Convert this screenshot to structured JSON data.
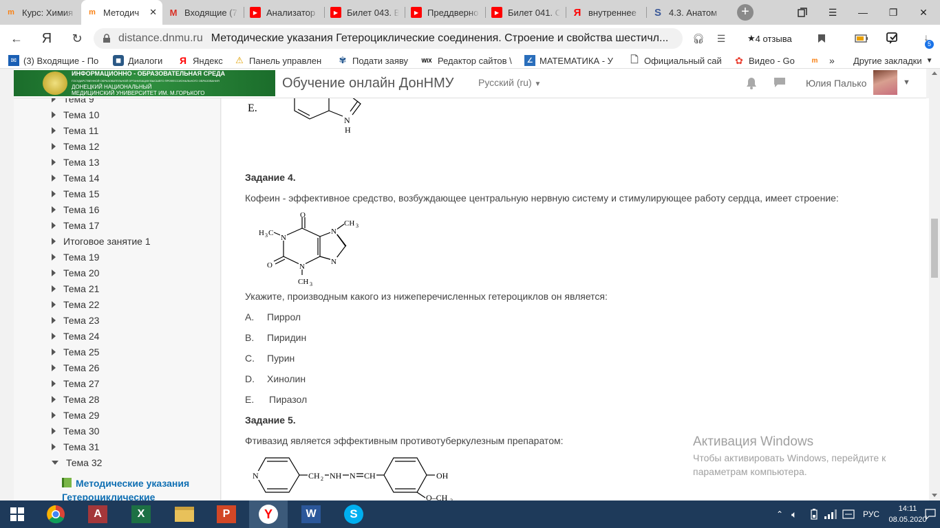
{
  "tabs": [
    {
      "title": "Курс: Химия",
      "icon": "moodle-icon",
      "color": "#f98012"
    },
    {
      "title": "Методич",
      "icon": "moodle-icon",
      "color": "#f98012",
      "active": true
    },
    {
      "title": "Входящие (7",
      "icon": "gmail-icon",
      "color": "#d93025"
    },
    {
      "title": "Анализатор",
      "icon": "youtube-icon",
      "color": "#ff0000"
    },
    {
      "title": "Билет 043. В",
      "icon": "youtube-icon",
      "color": "#ff0000"
    },
    {
      "title": "Преддверно",
      "icon": "youtube-icon",
      "color": "#ff0000"
    },
    {
      "title": "Билет 041. С",
      "icon": "youtube-icon",
      "color": "#ff0000"
    },
    {
      "title": "внутреннее",
      "icon": "yandex-icon",
      "color": "#ff0000"
    },
    {
      "title": "4.3. Анатом",
      "icon": "s-icon",
      "color": "#3b5998"
    }
  ],
  "addressbar": {
    "host": "distance.dnmu.ru",
    "page_title": "Методические указания Гетероциклические соединения. Строение и свойства шестичл...",
    "reviews": "4 отзыва",
    "downloads_badge": "5"
  },
  "bookmarks": [
    {
      "label": "(3) Входящие - По",
      "icon": "mail-icon",
      "color": "#1a5fb4"
    },
    {
      "label": "Диалоги",
      "icon": "chat-icon",
      "color": "#2a5885"
    },
    {
      "label": "Яндекс",
      "icon": "yandex-icon",
      "color": "#ff0000"
    },
    {
      "label": "Панель управлен",
      "icon": "panel-icon",
      "color": "#e0a000"
    },
    {
      "label": "Подати заяву",
      "icon": "emblem-icon",
      "color": "#1a4f8a"
    },
    {
      "label": "Редактор сайтов \\",
      "icon": "wix-icon",
      "color": "#000000"
    },
    {
      "label": "МАТЕМАТИКА - У",
      "icon": "math-icon",
      "color": "#2a6ebb"
    },
    {
      "label": "Официальный сай",
      "icon": "page-icon",
      "color": "#666666"
    },
    {
      "label": "Видео - Go",
      "icon": "photos-icon",
      "color": "#ea4335"
    },
    {
      "label": "",
      "icon": "moodle-icon",
      "color": "#f98012"
    }
  ],
  "bookmarks_other": "Другие закладки",
  "header": {
    "logo_line1": "ИНФОРМАЦИОННО - ОБРАЗОВАТЕЛЬНАЯ СРЕДА",
    "logo_line2": "ГОСУДАРСТВЕННОЙ ОБРАЗОВАТЕЛЬНОЙ ОРГАНИЗАЦИИ ВЫСШЕГО ПРОФЕССИОНАЛЬНОГО ОБРАЗОВАНИЯ",
    "logo_line3": "ДОНЕЦКИЙ НАЦИОНАЛЬНЫЙ",
    "logo_line4": "МЕДИЦИНСКИЙ УНИВЕРСИТЕТ ИМ. М.ГОРЬКОГО",
    "site_name": "Обучение онлайн ДонНМУ",
    "language": "Русский (ru)",
    "user_name": "Юлия Палько"
  },
  "sidebar": {
    "items": [
      "Тема 9",
      "Тема 10",
      "Тема 11",
      "Тема 12",
      "Тема 13",
      "Тема 14",
      "Тема 15",
      "Тема 16",
      "Тема 17",
      "Итоговое занятие 1",
      "Тема 19",
      "Тема 20",
      "Тема 21",
      "Тема 22",
      "Тема 23",
      "Тема 24",
      "Тема 25",
      "Тема 26",
      "Тема 27",
      "Тема 28",
      "Тема 29",
      "Тема 30",
      "Тема 31",
      "Тема 32"
    ],
    "active_line1": "Методические указания",
    "active_line2": "Гетероциклические"
  },
  "content": {
    "prev_option_letter": "E.",
    "task4_title": "Задание 4.",
    "task4_text": "Кофеин - эффективное средство, возбуждающее центральную нервную систему и стимулирующее работу сердца, имеет строение:",
    "task4_question": "Укажите, производным какого из нижеперечисленных гетероциклов он является:",
    "options": [
      {
        "letter": "A.",
        "text": "Пиррол"
      },
      {
        "letter": "B.",
        "text": "Пиридин"
      },
      {
        "letter": "C.",
        "text": "Пурин"
      },
      {
        "letter": "D.",
        "text": "Хинолин"
      },
      {
        "letter": "E.",
        "text": "Пиразол"
      }
    ],
    "task5_title": "Задание 5.",
    "task5_text": "Фтивазид является эффективным противотуберкулезным препаратом:"
  },
  "watermark": {
    "title": "Активация Windows",
    "line1": "Чтобы активировать Windows, перейдите к",
    "line2": "параметрам компьютера."
  },
  "taskbar": {
    "lang": "РУС",
    "time": "14:11",
    "date": "08.05.2020"
  }
}
